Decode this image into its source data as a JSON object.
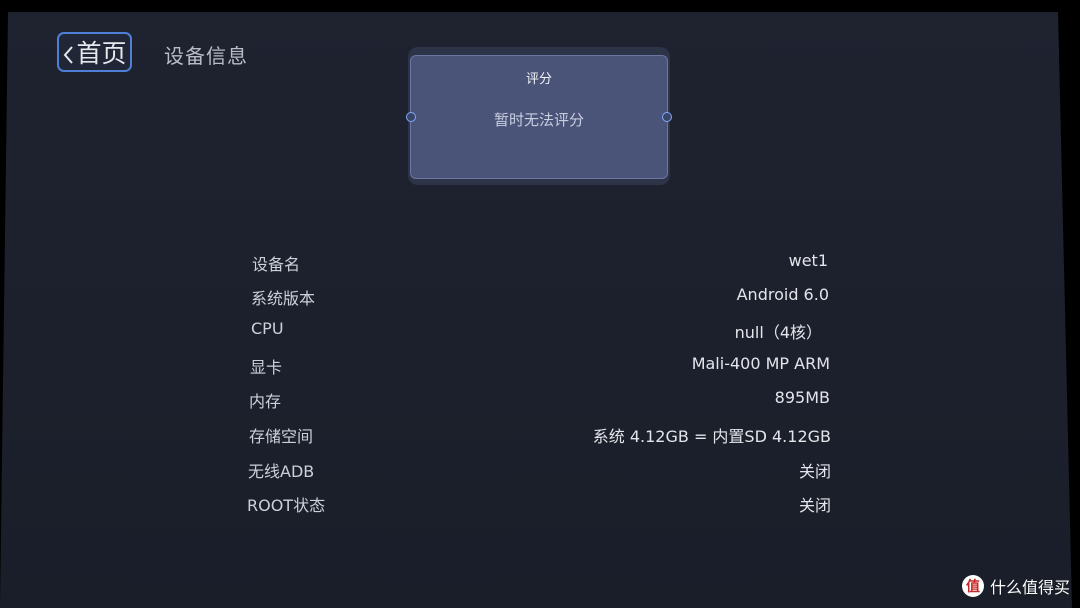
{
  "header": {
    "back_label": "首页",
    "title": "设备信息"
  },
  "score_card": {
    "title": "评分",
    "message": "暂时无法评分"
  },
  "info": [
    {
      "label": "设备名",
      "value": "wet1"
    },
    {
      "label": "系统版本",
      "value": "Android 6.0"
    },
    {
      "label": "CPU",
      "value": "null（4核）"
    },
    {
      "label": "显卡",
      "value": "Mali-400 MP ARM"
    },
    {
      "label": "内存",
      "value": "895MB"
    },
    {
      "label": "存储空间",
      "value": "系统 4.12GB = 内置SD 4.12GB"
    },
    {
      "label": "无线ADB",
      "value": "关闭"
    },
    {
      "label": "ROOT状态",
      "value": "关闭"
    }
  ],
  "watermark": {
    "logo": "值",
    "text": "什么值得买"
  },
  "colors": {
    "background": "#1e2230",
    "accent": "#4f7fd6",
    "card": "#4a5478"
  },
  "icons": {
    "back": "chevron-left-icon"
  }
}
